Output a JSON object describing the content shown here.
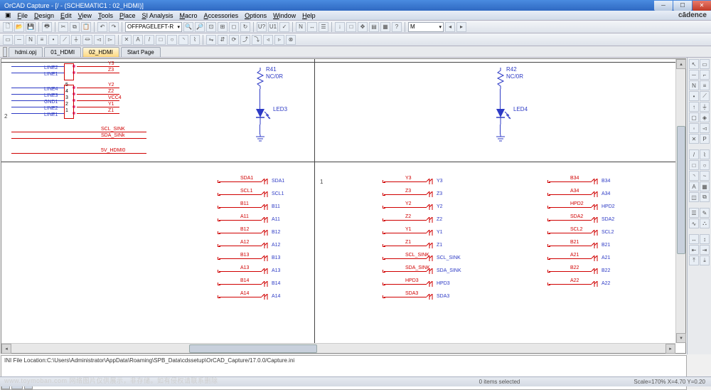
{
  "window": {
    "title": "OrCAD Capture - [/ - (SCHEMATIC1 : 02_HDMI)]",
    "brand": "cādence"
  },
  "menu": {
    "file": "File",
    "design": "Design",
    "edit": "Edit",
    "view": "View",
    "tools": "Tools",
    "place": "Place",
    "si": "SI Analysis",
    "macro": "Macro",
    "accessories": "Accessories",
    "options": "Options",
    "window": "Window",
    "help": "Help"
  },
  "toolbar": {
    "dropdown": "OFFPAGELEFT-R",
    "find": "M"
  },
  "tabs": {
    "t1": "hdmi.opj",
    "t2": "01_HDMI",
    "t3": "02_HDMI",
    "t4": "Start Page"
  },
  "log": {
    "line1": "INI File Location:C:\\Users\\Administrator\\AppData\\Roaming\\SPB_Data\\cdssetup\\OrCAD_Capture/17.0.0/Capture.ini"
  },
  "status": {
    "left": "www.toymoban.com  网络图片仅供展示，非存储。如有侵权请联系删除",
    "mid": "0  items selected",
    "right": "Scale=170%   X=4.70   Y=0.20"
  },
  "schematic": {
    "smallNets1": [
      "Y3",
      "Z3"
    ],
    "smallLines1": [
      "LINE2",
      "LINE1"
    ],
    "smallNets2": [
      "Y2",
      "Z2",
      "VCC4",
      "Y1",
      "Z1"
    ],
    "smallLines2": [
      "LINE4",
      "LINE3",
      "GND1",
      "LINE2",
      "LINE1"
    ],
    "pins2": [
      "5",
      "4",
      "3",
      "2",
      "1"
    ],
    "sinkNets": [
      "SCL_SINK",
      "SDA_SINk",
      "5V_HDMI0"
    ],
    "r41": {
      "ref": "R41",
      "val": "NC/0R"
    },
    "r42": {
      "ref": "R42",
      "val": "NC/0R"
    },
    "led3": "LED3",
    "led4": "LED4",
    "pageNum": "1",
    "portNum": "2",
    "col1": [
      {
        "net": "SDA1",
        "port": "SDA1"
      },
      {
        "net": "SCL1",
        "port": "SCL1"
      },
      {
        "net": "B11",
        "port": "B11"
      },
      {
        "net": "A11",
        "port": "A11"
      },
      {
        "net": "B12",
        "port": "B12"
      },
      {
        "net": "A12",
        "port": "A12"
      },
      {
        "net": "B13",
        "port": "B13"
      },
      {
        "net": "A13",
        "port": "A13"
      },
      {
        "net": "B14",
        "port": "B14"
      },
      {
        "net": "A14",
        "port": "A14"
      }
    ],
    "col2": [
      {
        "net": "Y3",
        "port": "Y3"
      },
      {
        "net": "Z3",
        "port": "Z3"
      },
      {
        "net": "Y2",
        "port": "Y2"
      },
      {
        "net": "Z2",
        "port": "Z2"
      },
      {
        "net": "Y1",
        "port": "Y1"
      },
      {
        "net": "Z1",
        "port": "Z1"
      },
      {
        "net": "SCL_SINK",
        "port": "SCL_SINK"
      },
      {
        "net": "SDA_SINK",
        "port": "SDA_SINK"
      },
      {
        "net": "HPD3",
        "port": "HPD3"
      },
      {
        "net": "SDA3",
        "port": "SDA3"
      }
    ],
    "col3": [
      {
        "net": "B34",
        "port": "B34"
      },
      {
        "net": "A34",
        "port": "A34"
      },
      {
        "net": "HPD2",
        "port": "HPD2"
      },
      {
        "net": "SDA2",
        "port": "SDA2"
      },
      {
        "net": "SCL2",
        "port": "SCL2"
      },
      {
        "net": "B21",
        "port": "B21"
      },
      {
        "net": "A21",
        "port": "A21"
      },
      {
        "net": "B22",
        "port": "B22"
      },
      {
        "net": "A22",
        "port": "A22"
      }
    ]
  }
}
